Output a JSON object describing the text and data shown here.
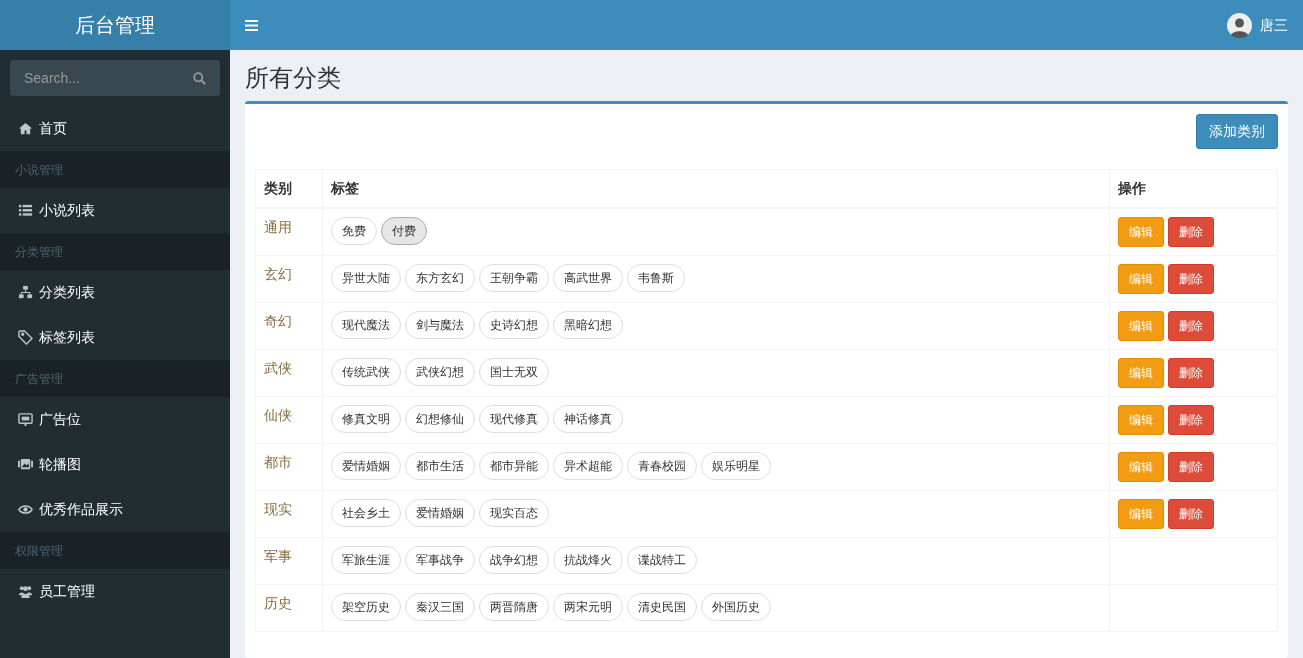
{
  "brand": "后台管理",
  "sidebar": {
    "search": {
      "placeholder": "Search..."
    },
    "items": [
      {
        "kind": "link",
        "label": "首页"
      },
      {
        "kind": "header",
        "label": "小说管理"
      },
      {
        "kind": "link",
        "label": "小说列表"
      },
      {
        "kind": "header",
        "label": "分类管理"
      },
      {
        "kind": "link",
        "label": "分类列表"
      },
      {
        "kind": "link",
        "label": "标签列表"
      },
      {
        "kind": "header",
        "label": "广告管理"
      },
      {
        "kind": "link",
        "label": "广告位"
      },
      {
        "kind": "link",
        "label": "轮播图"
      },
      {
        "kind": "link",
        "label": "优秀作品展示"
      },
      {
        "kind": "header",
        "label": "权限管理"
      },
      {
        "kind": "link",
        "label": "员工管理"
      }
    ]
  },
  "user": {
    "name": "唐三"
  },
  "page_title": "所有分类",
  "add_button": "添加类别",
  "table": {
    "columns": [
      "类别",
      "标签",
      "操作"
    ],
    "rows": [
      {
        "category": "通用",
        "tags": [
          {
            "label": "免费",
            "selected": false
          },
          {
            "label": "付费",
            "selected": true
          }
        ],
        "actions": [
          {
            "kind": "edit",
            "label": "编辑"
          },
          {
            "kind": "delete",
            "label": "删除"
          }
        ]
      },
      {
        "category": "玄幻",
        "tags": [
          {
            "label": "异世大陆",
            "selected": false
          },
          {
            "label": "东方玄幻",
            "selected": false
          },
          {
            "label": "王朝争霸",
            "selected": false
          },
          {
            "label": "高武世界",
            "selected": false
          },
          {
            "label": "韦鲁斯",
            "selected": false
          }
        ],
        "actions": [
          {
            "kind": "edit",
            "label": "编辑"
          },
          {
            "kind": "delete",
            "label": "删除"
          }
        ]
      },
      {
        "category": "奇幻",
        "tags": [
          {
            "label": "现代魔法",
            "selected": false
          },
          {
            "label": "剑与魔法",
            "selected": false
          },
          {
            "label": "史诗幻想",
            "selected": false
          },
          {
            "label": "黑暗幻想",
            "selected": false
          }
        ],
        "actions": [
          {
            "kind": "edit",
            "label": "编辑"
          },
          {
            "kind": "delete",
            "label": "删除"
          }
        ]
      },
      {
        "category": "武侠",
        "tags": [
          {
            "label": "传统武侠",
            "selected": false
          },
          {
            "label": "武侠幻想",
            "selected": false
          },
          {
            "label": "国士无双",
            "selected": false
          }
        ],
        "actions": [
          {
            "kind": "edit",
            "label": "编辑"
          },
          {
            "kind": "delete",
            "label": "删除"
          }
        ]
      },
      {
        "category": "仙侠",
        "tags": [
          {
            "label": "修真文明",
            "selected": false
          },
          {
            "label": "幻想修仙",
            "selected": false
          },
          {
            "label": "现代修真",
            "selected": false
          },
          {
            "label": "神话修真",
            "selected": false
          }
        ],
        "actions": [
          {
            "kind": "edit",
            "label": "编辑"
          },
          {
            "kind": "delete",
            "label": "删除"
          }
        ]
      },
      {
        "category": "都市",
        "tags": [
          {
            "label": "爱情婚姻",
            "selected": false
          },
          {
            "label": "都市生活",
            "selected": false
          },
          {
            "label": "都市异能",
            "selected": false
          },
          {
            "label": "异术超能",
            "selected": false
          },
          {
            "label": "青春校园",
            "selected": false
          },
          {
            "label": "娱乐明星",
            "selected": false
          }
        ],
        "actions": [
          {
            "kind": "edit",
            "label": "编辑"
          },
          {
            "kind": "delete",
            "label": "删除"
          }
        ]
      },
      {
        "category": "现实",
        "tags": [
          {
            "label": "社会乡土",
            "selected": false
          },
          {
            "label": "爱情婚姻",
            "selected": false
          },
          {
            "label": "现实百态",
            "selected": false
          }
        ],
        "actions": [
          {
            "kind": "edit",
            "label": "编辑"
          },
          {
            "kind": "delete",
            "label": "删除"
          }
        ]
      },
      {
        "category": "军事",
        "tags": [
          {
            "label": "军旅生涯",
            "selected": false
          },
          {
            "label": "军事战争",
            "selected": false
          },
          {
            "label": "战争幻想",
            "selected": false
          },
          {
            "label": "抗战烽火",
            "selected": false
          },
          {
            "label": "谍战特工",
            "selected": false
          }
        ]
      },
      {
        "category": "历史",
        "tags": [
          {
            "label": "架空历史",
            "selected": false
          },
          {
            "label": "秦汉三国",
            "selected": false
          },
          {
            "label": "两晋隋唐",
            "selected": false
          },
          {
            "label": "两宋元明",
            "selected": false
          },
          {
            "label": "清史民国",
            "selected": false
          },
          {
            "label": "外国历史",
            "selected": false
          }
        ]
      }
    ]
  }
}
